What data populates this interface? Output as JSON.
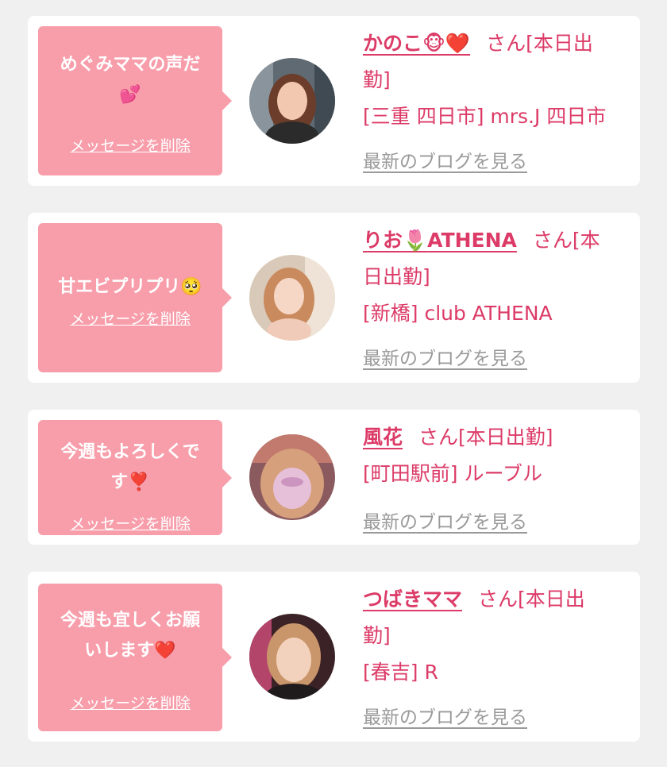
{
  "common": {
    "delete_label": "メッセージを削除",
    "blog_label": "最新のブログを見る",
    "san_label": "さん",
    "accent_color": "#dc3b67",
    "bubble_color": "#f89eab"
  },
  "cards": [
    {
      "message_line1": "めぐみママの声だ",
      "message_line2": "💕",
      "girl_name": "かのこ",
      "name_emoji": "🐵❤️",
      "status_line1": "[本日出",
      "status_line2": "勤]",
      "location": "[三重 四日市] mrs.J 四日市"
    },
    {
      "message_line1": "甘エビプリプリ🥺",
      "girl_name": "りお",
      "name_emoji": "🌷",
      "name_suffix": "ATHENA",
      "status_line1": "[本",
      "status_line2": "日出勤]",
      "location": "[新橋] club ATHENA"
    },
    {
      "message_line1": "今週もよろしくで",
      "message_line2": "す❣️",
      "girl_name": "風花",
      "status_line1": "[本日出勤]",
      "location": "[町田駅前] ルーブル"
    },
    {
      "message_line1": "今週も宜しくお願",
      "message_line2": "いします❤️",
      "girl_name": "つばきママ",
      "status_line1": "[本日出",
      "status_line2": "勤]",
      "location": "[春吉] R"
    }
  ]
}
